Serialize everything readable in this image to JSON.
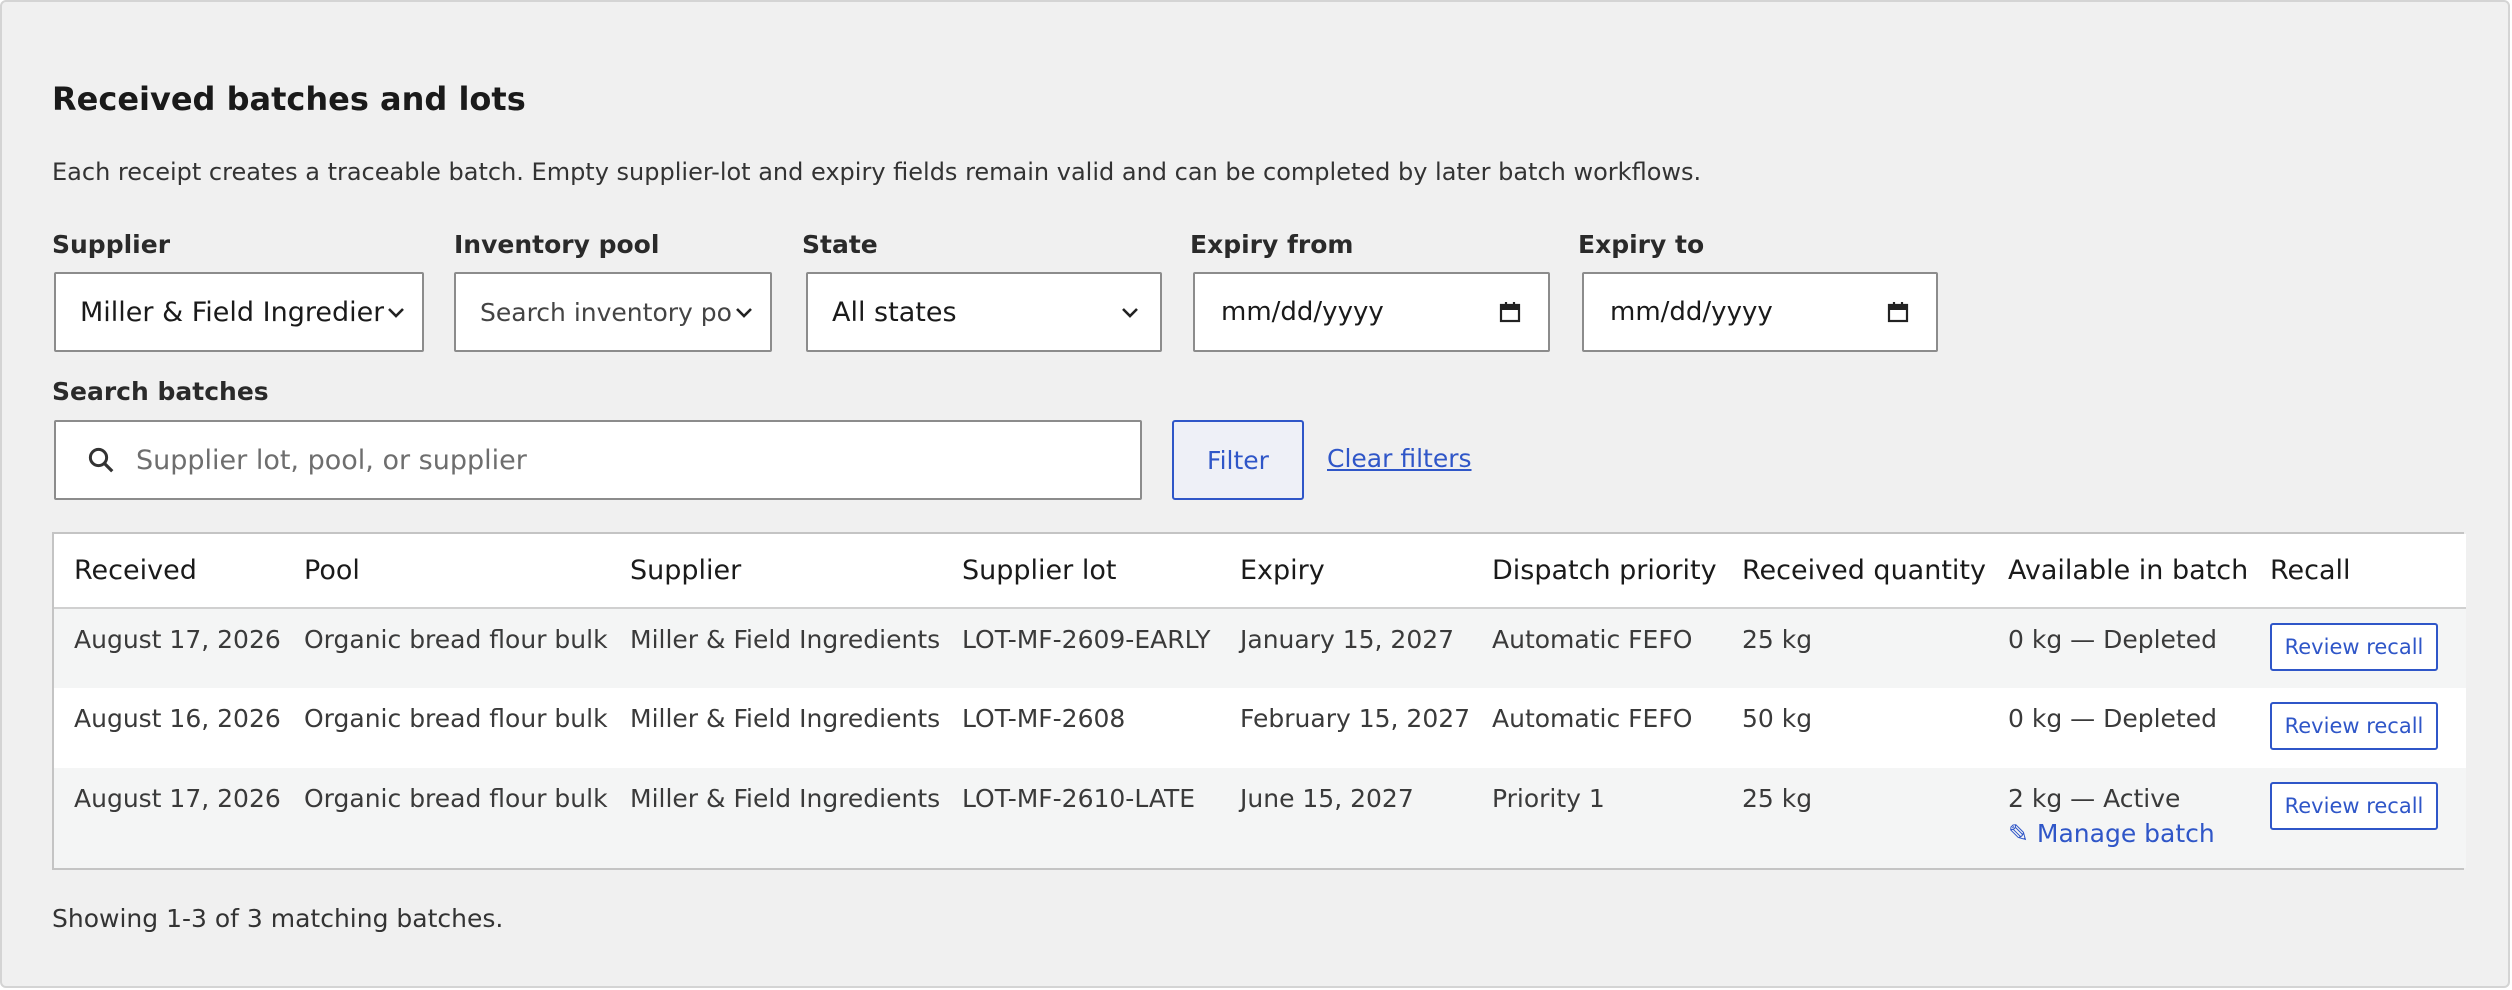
{
  "page": {
    "title": "Received batches and lots",
    "description": "Each receipt creates a traceable batch. Empty supplier-lot and expiry fields remain valid and can be completed by later batch workflows."
  },
  "filters": {
    "supplier": {
      "label": "Supplier",
      "value": "Miller & Field Ingredients"
    },
    "inventory_pool": {
      "label": "Inventory pool",
      "placeholder": "Search inventory pools"
    },
    "state": {
      "label": "State",
      "value": "All states"
    },
    "expiry_from": {
      "label": "Expiry from",
      "placeholder": "mm/dd/yyyy"
    },
    "expiry_to": {
      "label": "Expiry to",
      "placeholder": "mm/dd/yyyy"
    },
    "search": {
      "label": "Search batches",
      "placeholder": "Supplier lot, pool, or supplier"
    },
    "filter_label": "Filter",
    "clear_label": "Clear filters"
  },
  "table": {
    "columns": [
      "Received",
      "Pool",
      "Supplier",
      "Supplier lot",
      "Expiry",
      "Dispatch priority",
      "Received quantity",
      "Available in batch",
      "Recall"
    ],
    "rows": [
      {
        "received": "August 17, 2026",
        "pool": "Organic bread flour bulk",
        "supplier": "Miller & Field Ingredients",
        "lot": "LOT-MF-2609-EARLY",
        "expiry": "January 15, 2027",
        "priority": "Automatic FEFO",
        "quantity": "25 kg",
        "available": "0 kg — Depleted",
        "recall": "Review recall"
      },
      {
        "received": "August 16, 2026",
        "pool": "Organic bread flour bulk",
        "supplier": "Miller & Field Ingredients",
        "lot": "LOT-MF-2608",
        "expiry": "February 15, 2027",
        "priority": "Automatic FEFO",
        "quantity": "50 kg",
        "available": "0 kg — Depleted",
        "recall": "Review recall"
      },
      {
        "received": "August 17, 2026",
        "pool": "Organic bread flour bulk",
        "supplier": "Miller & Field Ingredients",
        "lot": "LOT-MF-2610-LATE",
        "expiry": "June 15, 2027",
        "priority": "Priority 1",
        "quantity": "25 kg",
        "available": "2 kg — Active",
        "manage": "✎ Manage batch",
        "recall": "Review recall"
      }
    ]
  },
  "footer": {
    "summary": "Showing 1-3 of 3 matching batches."
  },
  "colors": {
    "accent": "#2f56c8",
    "panel_bg": "#f0f0f0",
    "row_alt": "#f4f5f5"
  },
  "icons": {
    "search": "search-icon",
    "select": "chevron-down-icon",
    "calendar": "calendar-icon",
    "edit": "pencil-icon"
  }
}
